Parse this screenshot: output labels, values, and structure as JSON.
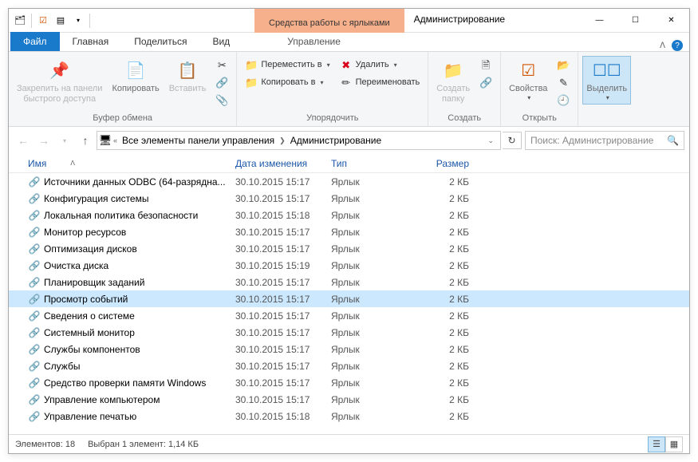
{
  "window": {
    "context_tab": "Средства работы с ярлыками",
    "title": "Администрирование"
  },
  "tabs": {
    "file": "Файл",
    "home": "Главная",
    "share": "Поделиться",
    "view": "Вид",
    "manage": "Управление"
  },
  "ribbon": {
    "pin": "Закрепить на панели\nбыстрого доступа",
    "copy": "Копировать",
    "paste": "Вставить",
    "clipboard_group": "Буфер обмена",
    "move_to": "Переместить в",
    "copy_to": "Копировать в",
    "delete": "Удалить",
    "rename": "Переименовать",
    "organize_group": "Упорядочить",
    "new_folder": "Создать\nпапку",
    "new_group": "Создать",
    "properties": "Свойства",
    "open_group": "Открыть",
    "select": "Выделить"
  },
  "address": {
    "seg1": "Все элементы панели управления",
    "seg2": "Администрирование"
  },
  "search_placeholder": "Поиск: Администрирование",
  "columns": {
    "name": "Имя",
    "date": "Дата изменения",
    "type": "Тип",
    "size": "Размер"
  },
  "rows": [
    {
      "name": "Источники данных ODBC (64-разрядна...",
      "date": "30.10.2015 15:17",
      "type": "Ярлык",
      "size": "2 КБ",
      "sel": false
    },
    {
      "name": "Конфигурация системы",
      "date": "30.10.2015 15:17",
      "type": "Ярлык",
      "size": "2 КБ",
      "sel": false
    },
    {
      "name": "Локальная политика безопасности",
      "date": "30.10.2015 15:18",
      "type": "Ярлык",
      "size": "2 КБ",
      "sel": false
    },
    {
      "name": "Монитор ресурсов",
      "date": "30.10.2015 15:17",
      "type": "Ярлык",
      "size": "2 КБ",
      "sel": false
    },
    {
      "name": "Оптимизация дисков",
      "date": "30.10.2015 15:17",
      "type": "Ярлык",
      "size": "2 КБ",
      "sel": false
    },
    {
      "name": "Очистка диска",
      "date": "30.10.2015 15:19",
      "type": "Ярлык",
      "size": "2 КБ",
      "sel": false
    },
    {
      "name": "Планировщик заданий",
      "date": "30.10.2015 15:17",
      "type": "Ярлык",
      "size": "2 КБ",
      "sel": false
    },
    {
      "name": "Просмотр событий",
      "date": "30.10.2015 15:17",
      "type": "Ярлык",
      "size": "2 КБ",
      "sel": true
    },
    {
      "name": "Сведения о системе",
      "date": "30.10.2015 15:17",
      "type": "Ярлык",
      "size": "2 КБ",
      "sel": false
    },
    {
      "name": "Системный монитор",
      "date": "30.10.2015 15:17",
      "type": "Ярлык",
      "size": "2 КБ",
      "sel": false
    },
    {
      "name": "Службы компонентов",
      "date": "30.10.2015 15:17",
      "type": "Ярлык",
      "size": "2 КБ",
      "sel": false
    },
    {
      "name": "Службы",
      "date": "30.10.2015 15:17",
      "type": "Ярлык",
      "size": "2 КБ",
      "sel": false
    },
    {
      "name": "Средство проверки памяти Windows",
      "date": "30.10.2015 15:17",
      "type": "Ярлык",
      "size": "2 КБ",
      "sel": false
    },
    {
      "name": "Управление компьютером",
      "date": "30.10.2015 15:17",
      "type": "Ярлык",
      "size": "2 КБ",
      "sel": false
    },
    {
      "name": "Управление печатью",
      "date": "30.10.2015 15:18",
      "type": "Ярлык",
      "size": "2 КБ",
      "sel": false
    }
  ],
  "status": {
    "count": "Элементов: 18",
    "selection": "Выбран 1 элемент: 1,14 КБ"
  }
}
